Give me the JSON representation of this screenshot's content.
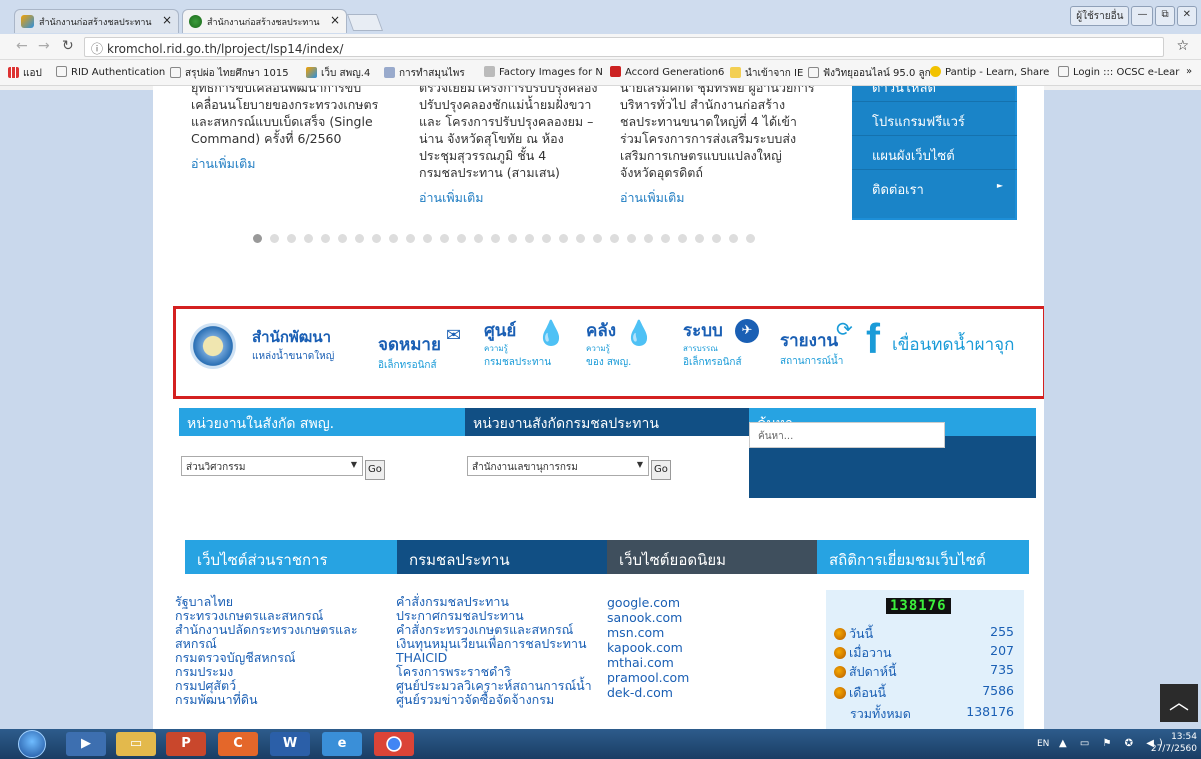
{
  "browser": {
    "tabs": [
      {
        "title": "สำนักงานก่อสร้างชลประทาน"
      },
      {
        "title": "สำนักงานก่อสร้างชลประทาน"
      }
    ],
    "window_buttons": [
      "ผู้ใช้รายอื่น",
      "—",
      "⧉",
      "✕"
    ],
    "url": "kromchol.rid.go.th/lproject/lsp14/index/",
    "bookmarks": [
      "แอป",
      "RID Authentication",
      "สรุปผ่อ ไทยศึกษา 1015",
      "เว็บ สพญ.4",
      "การทำสมุนไพร",
      "Factory Images for N",
      "Accord Generation6",
      "นำเข้าจาก IE",
      "ฟังวิทยุออนไลน์ 95.0 ลูก",
      "Pantip - Learn, Share",
      "Login ::: OCSC e-Lear",
      "»"
    ]
  },
  "news": [
    {
      "lines": [
        "ยุทธการขับเคลื่อนพัฒนาการขับ",
        "เคลื่อนนโยบายของกระทรวงเกษตร",
        "และสหกรณ์แบบเบ็ดเสร็จ (Single",
        "Command) ครั้งที่ 6/2560"
      ],
      "more": "อ่านเพิ่มเติม"
    },
    {
      "lines": [
        "ตรวจเยี่ยมโครงการปรับปรุงคลอง",
        "ปรับปรุงคลองชักแม่น้ำยมฝั่งขวา",
        "และ โครงการปรับปรุงคลองยม –",
        "น่าน จังหวัดสุโขทัย ณ ห้อง",
        "ประชุมสุวรรณภูมิ ชั้น 4",
        "กรมชลประทาน (สามเสน)"
      ],
      "more": "อ่านเพิ่มเติม"
    },
    {
      "lines": [
        "นายเสริมศักดิ์ ชุมทรัพย์ ผู้อำนวยการ",
        "บริหารทั่วไป สำนักงานก่อสร้าง",
        "ชลประทานขนาดใหญ่ที่ 4 ได้เข้า",
        "ร่วมโครงการการส่งเสริมระบบส่ง",
        "เสริมการเกษตรแบบแปลงใหญ่",
        "จังหวัดอุตรดิตถ์"
      ],
      "more": "อ่านเพิ่มเติม"
    }
  ],
  "side_menu": [
    "ดาวน์โหลด",
    "โปรแกรมฟรีแวร์",
    "แผนผังเว็บไซต์",
    "ติดต่อเรา"
  ],
  "banner": [
    {
      "big": "สำนักพัฒนา",
      "small": "แหล่งน้ำขนาดใหญ่"
    },
    {
      "big": "จดหมาย",
      "small": "อิเล็กทรอนิกส์"
    },
    {
      "big": "ศูนย์",
      "sub": "ความรู้",
      "small": "กรมชลประทาน"
    },
    {
      "big": "คลัง",
      "sub": "ความรู้",
      "small": "ของ สพญ."
    },
    {
      "big": "ระบบ",
      "sub": "สารบรรณ",
      "small": "อิเล็กทรอนิกส์"
    },
    {
      "big": "รายงาน",
      "small": "สถานการณ์น้ำ"
    },
    {
      "big": "เขื่อนทดน้ำผาจุก",
      "fb": "f"
    }
  ],
  "units": {
    "h1": "หน่วยงานในสังกัด สพญ.",
    "h2": "หน่วยงานสังกัดกรมชลประทาน",
    "h3": "ค้นหา",
    "select1": "ส่วนวิศวกรรม",
    "select2": "สำนักงานเลขานุการกรม",
    "go": "Go",
    "search_placeholder": "ค้นหา..."
  },
  "links": {
    "h1": "เว็บไซต์ส่วนราชการ",
    "h2": "กรมชลประทาน",
    "h3": "เว็บไซต์ยอดนิยม",
    "h4": "สถิติการเยี่ยมชมเว็บไซต์",
    "gov": [
      "รัฐบาลไทย",
      "กระทรวงเกษตรและสหกรณ์",
      "สำนักงานปลัดกระทรวงเกษตรและ",
      "สหกรณ์",
      "กรมตรวจบัญชีสหกรณ์",
      "กรมประมง",
      "กรมปศุสัตว์",
      "กรมพัฒนาที่ดิน"
    ],
    "rid": [
      "คำสั่งกรมชลประทาน",
      "ประกาศกรมชลประทาน",
      "คำสั่งกระทรวงเกษตรและสหกรณ์",
      "เงินทุนหมุนเวียนเพื่อการชลประทาน",
      "THAICID",
      "โครงการพระราชดำริ",
      "ศูนย์ประมวลวิเคราะห์สถานการณ์น้ำ",
      "ศูนย์รวมข่าวจัดซื้อจัดจ้างกรม"
    ],
    "popular": [
      "google.com",
      "sanook.com",
      "msn.com",
      "kapook.com",
      "mthai.com",
      "pramool.com",
      "dek-d.com"
    ]
  },
  "stats": {
    "counter": "138176",
    "rows": [
      {
        "label": "วันนี้",
        "value": "255"
      },
      {
        "label": "เมื่อวาน",
        "value": "207"
      },
      {
        "label": "สัปดาห์นี้",
        "value": "735"
      },
      {
        "label": "เดือนนี้",
        "value": "7586"
      },
      {
        "label": "รวมทั้งหมด",
        "value": "138176"
      }
    ]
  },
  "taskbar": {
    "lang": "EN",
    "time": "13:54",
    "date": "27/7/2560"
  },
  "colors": {
    "accent_blue": "#1a84c8",
    "banner_border": "#d42020",
    "dark_header": "#114f84"
  }
}
